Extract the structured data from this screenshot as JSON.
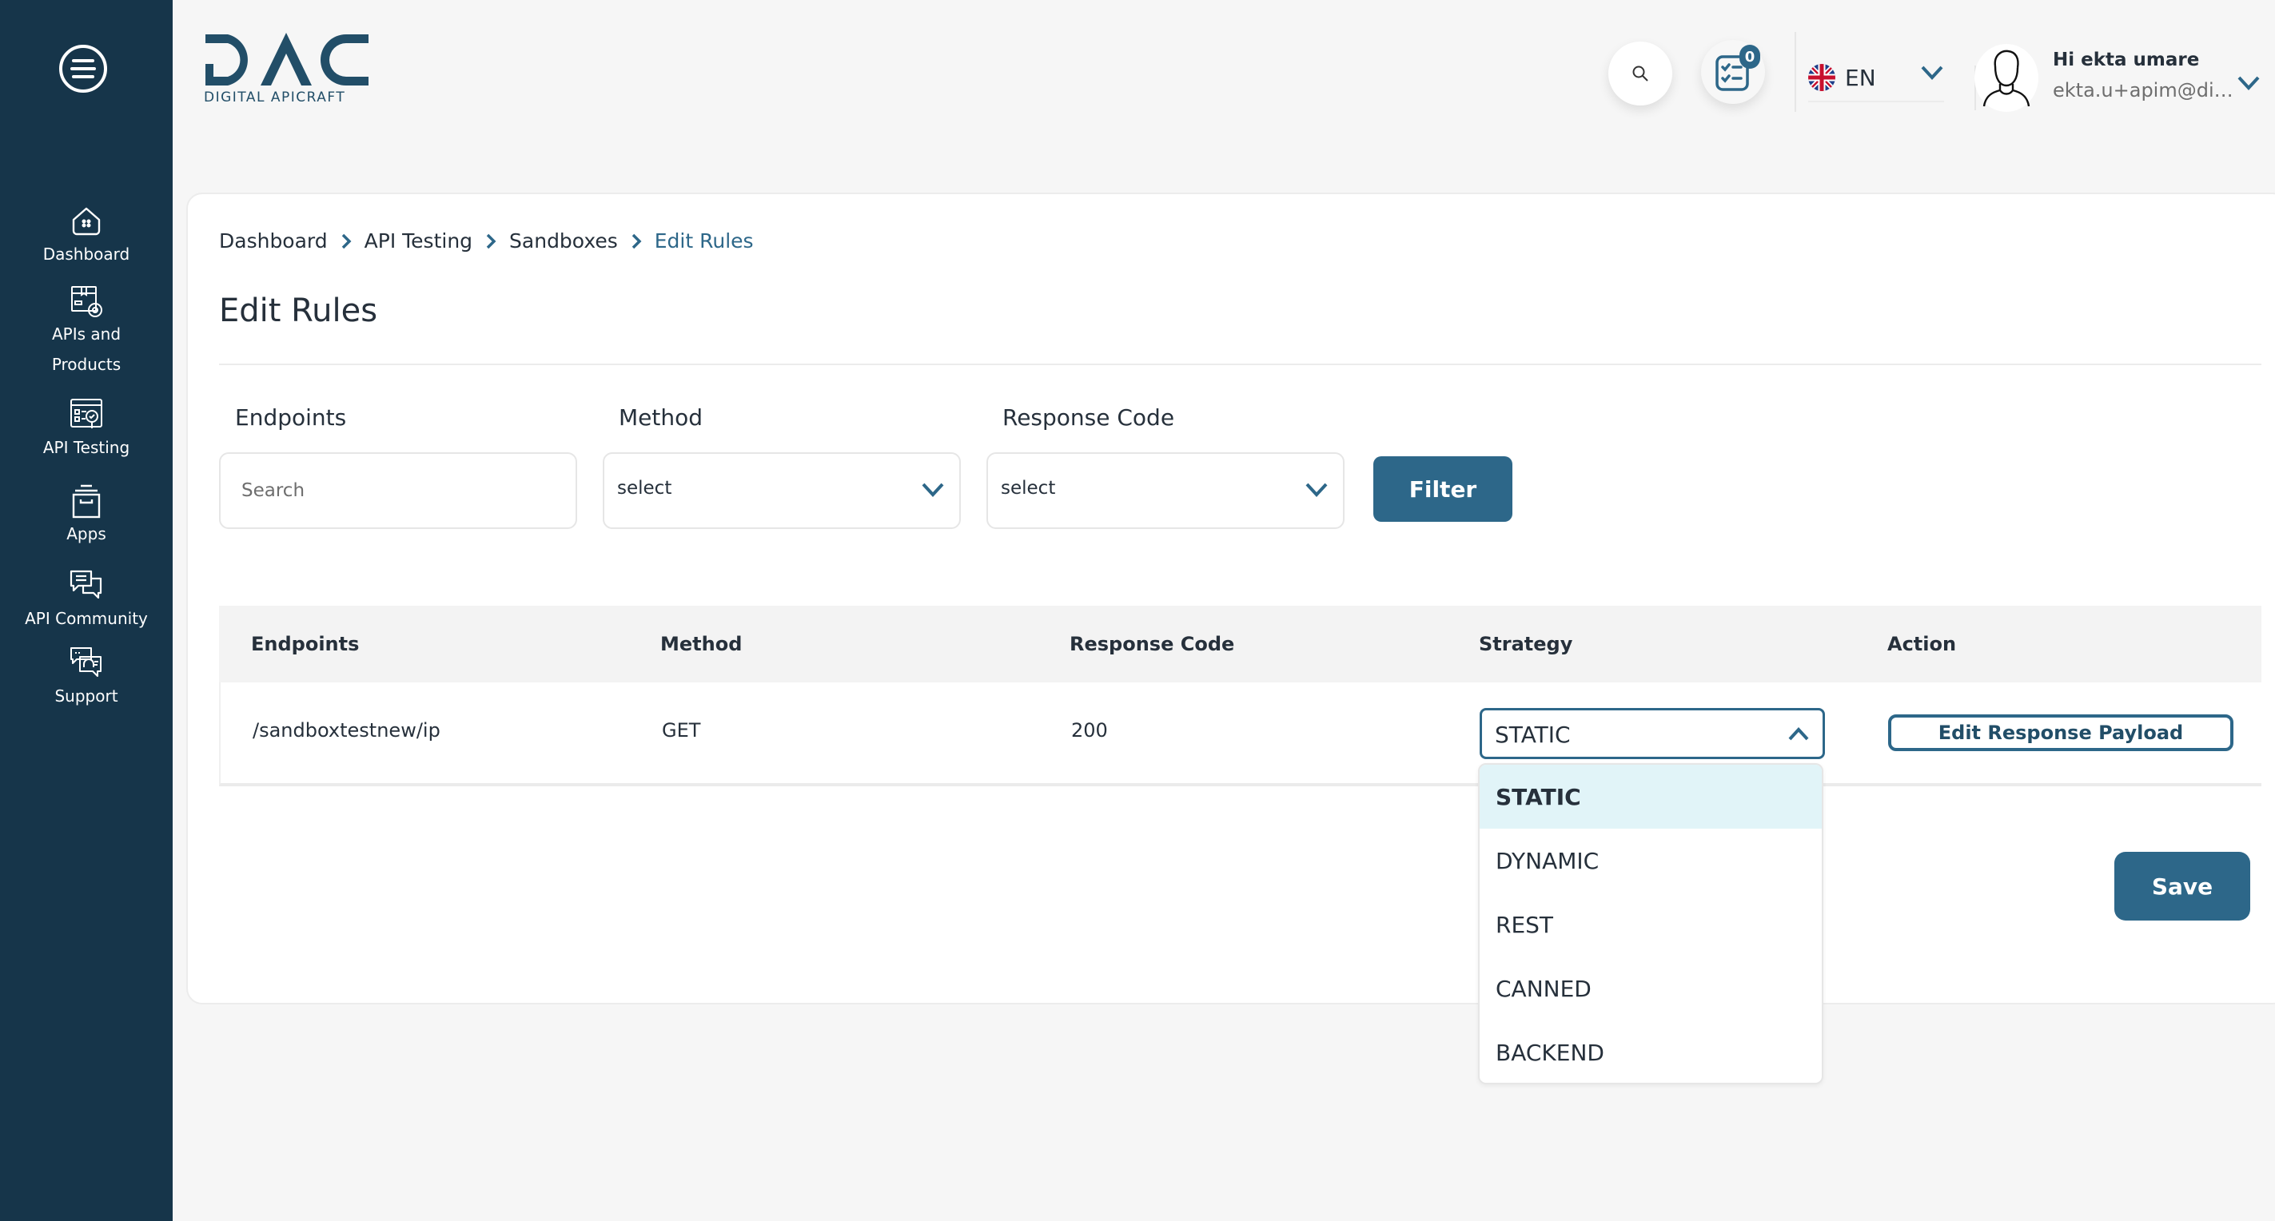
{
  "app": {
    "logo_text": "DAC",
    "logo_subtitle": "DIGITAL APICRAFT"
  },
  "sidebar": {
    "menu_icon": "hamburger-menu-icon",
    "items": [
      {
        "label": "Dashboard",
        "icon": "home-icon"
      },
      {
        "label": "APIs and",
        "label2": "Products",
        "icon": "package-gear-icon"
      },
      {
        "label": "API Testing",
        "icon": "test-report-icon"
      },
      {
        "label": "Apps",
        "icon": "archive-box-icon"
      },
      {
        "label": "API Community",
        "icon": "chat-bubbles-icon"
      },
      {
        "label": "Support",
        "icon": "support-chat-icon"
      }
    ]
  },
  "header": {
    "search_icon": "search-icon",
    "tasks_icon": "checklist-icon",
    "tasks_badge": "0",
    "language": {
      "code": "EN",
      "flag": "uk-flag-icon"
    },
    "user": {
      "greeting": "Hi ekta umare",
      "email": "ekta.u+apim@digi..."
    }
  },
  "breadcrumb": [
    {
      "label": "Dashboard"
    },
    {
      "label": "API Testing"
    },
    {
      "label": "Sandboxes"
    },
    {
      "label": "Edit Rules",
      "active": true
    }
  ],
  "page": {
    "title": "Edit Rules"
  },
  "filters": {
    "endpoints": {
      "label": "Endpoints",
      "placeholder": "Search",
      "value": ""
    },
    "method": {
      "label": "Method",
      "value": "select"
    },
    "response_code": {
      "label": "Response Code",
      "value": "select"
    },
    "filter_button": "Filter"
  },
  "table": {
    "columns": [
      "Endpoints",
      "Method",
      "Response Code",
      "Strategy",
      "Action"
    ],
    "rows": [
      {
        "endpoint": "/sandboxtestnew/ip",
        "method": "GET",
        "response_code": "200",
        "strategy": "STATIC",
        "action_label": "Edit Response Payload"
      }
    ]
  },
  "strategy_dropdown": {
    "open": true,
    "selected": "STATIC",
    "options": [
      "STATIC",
      "DYNAMIC",
      "REST",
      "CANNED",
      "BACKEND"
    ]
  },
  "save_button": "Save",
  "colors": {
    "sidebar": "#16354a",
    "primary": "#2d6789",
    "logo": "#224e68",
    "selected_option_bg": "#e1f4f8",
    "page_bg": "#f6f6f6"
  }
}
